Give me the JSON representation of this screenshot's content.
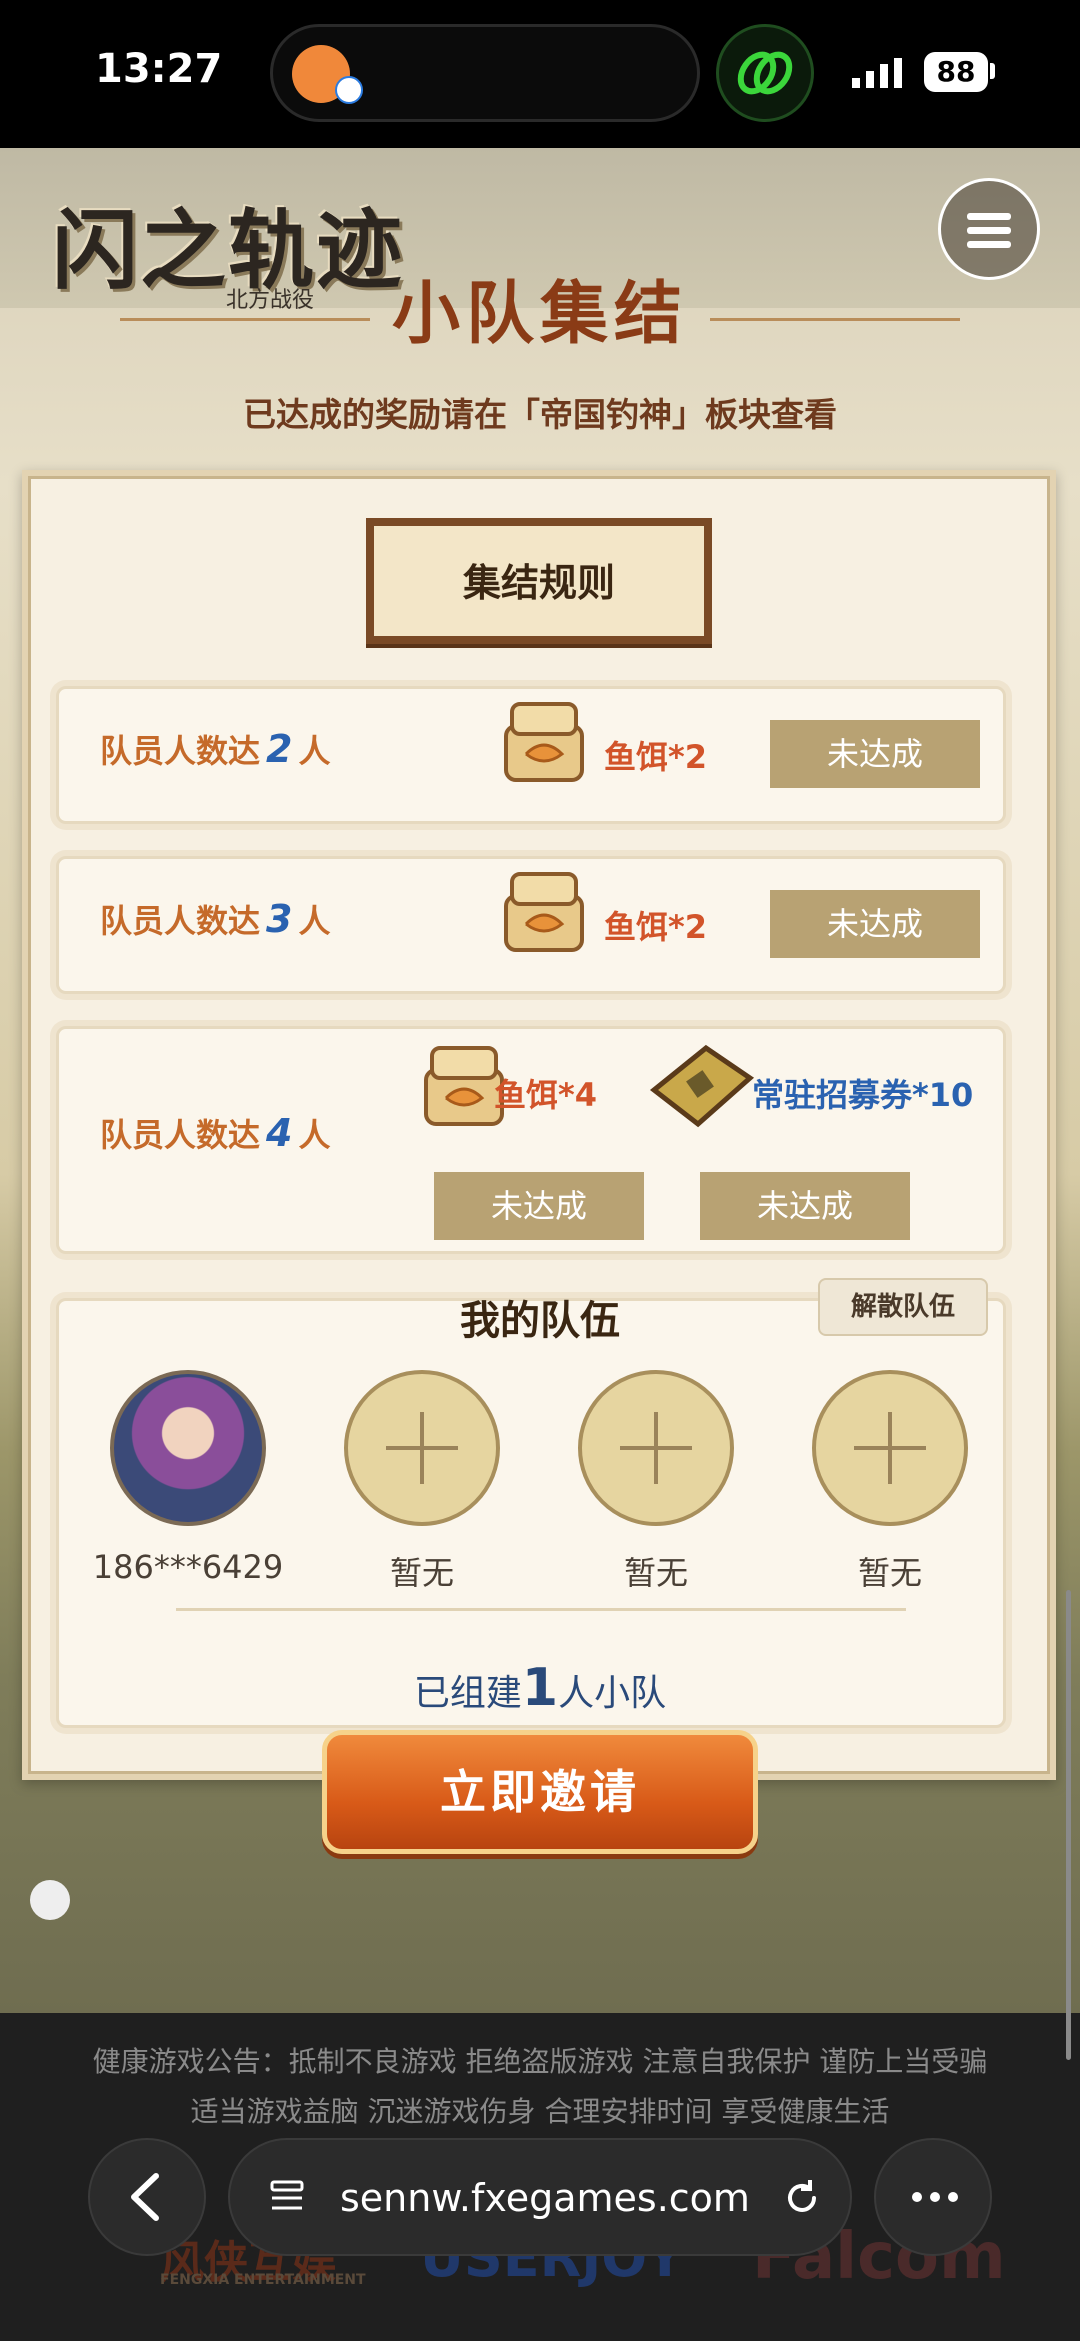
{
  "status_bar": {
    "time": "13:27",
    "battery": "88"
  },
  "header": {
    "logo_title": "闪之轨迹",
    "logo_subtitle": "北方战役",
    "page_title": "小队集结"
  },
  "notice": "已达成的奖励请在「帝国钓神」板块查看",
  "rules": {
    "title": "集结规则",
    "tiers": [
      {
        "label": "队员人数达",
        "count": "2",
        "unit": "人",
        "rewards": [
          {
            "name": "鱼饵*2",
            "status": "未达成"
          }
        ]
      },
      {
        "label": "队员人数达",
        "count": "3",
        "unit": "人",
        "rewards": [
          {
            "name": "鱼饵*2",
            "status": "未达成"
          }
        ]
      },
      {
        "label": "队员人数达",
        "count": "4",
        "unit": "人",
        "rewards": [
          {
            "name": "鱼饵*4",
            "status": "未达成"
          },
          {
            "name": "常驻招募券*10",
            "status": "未达成"
          }
        ]
      }
    ]
  },
  "team": {
    "title": "我的队伍",
    "disband_label": "解散队伍",
    "members": [
      {
        "name": "186***6429",
        "filled": true
      },
      {
        "name": "暂无",
        "filled": false
      },
      {
        "name": "暂无",
        "filled": false
      },
      {
        "name": "暂无",
        "filled": false
      }
    ],
    "built_prefix": "已组建",
    "built_count": "1",
    "built_suffix": "人小队"
  },
  "invite_label": "立即邀请",
  "footer": {
    "line1": "健康游戏公告：抵制不良游戏 拒绝盗版游戏 注意自我保护 谨防上当受骗",
    "line2": "适当游戏益脑 沉迷游戏伤身 合理安排时间 享受健康生活",
    "brands": [
      "FENGXIA ENTERTAINMENT",
      "USERJOY",
      "Falcom"
    ]
  },
  "browser": {
    "url": "sennw.fxegames.com"
  },
  "colors": {
    "accent_orange": "#d85a18",
    "status_button": "#b8a273",
    "reward_red": "#d2542a",
    "reward_blue": "#2a62b0"
  }
}
